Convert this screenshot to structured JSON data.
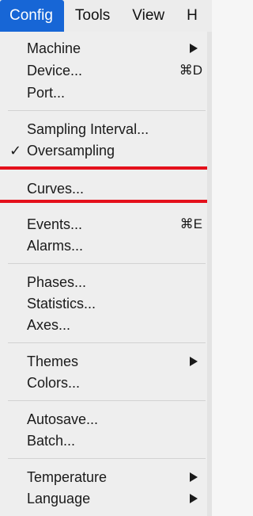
{
  "menubar": {
    "items": [
      {
        "label": "Config"
      },
      {
        "label": "Tools"
      },
      {
        "label": "View"
      },
      {
        "label": "H"
      }
    ]
  },
  "menu": {
    "items": [
      {
        "label": "Machine",
        "submenu": true
      },
      {
        "label": "Device...",
        "shortcut": "⌘D"
      },
      {
        "label": "Port..."
      },
      {
        "label": "Sampling Interval..."
      },
      {
        "label": "Oversampling",
        "checked": true,
        "check_mark": "✓"
      },
      {
        "label": "Curves...",
        "highlighted": true
      },
      {
        "label": "Events...",
        "shortcut": "⌘E"
      },
      {
        "label": "Alarms..."
      },
      {
        "label": "Phases..."
      },
      {
        "label": "Statistics..."
      },
      {
        "label": "Axes..."
      },
      {
        "label": "Themes",
        "submenu": true
      },
      {
        "label": "Colors..."
      },
      {
        "label": "Autosave..."
      },
      {
        "label": "Batch..."
      },
      {
        "label": "Temperature",
        "submenu": true
      },
      {
        "label": "Language",
        "submenu": true
      }
    ]
  },
  "colors": {
    "active_menu": "#1766d6",
    "highlight_line": "#e4101b"
  }
}
